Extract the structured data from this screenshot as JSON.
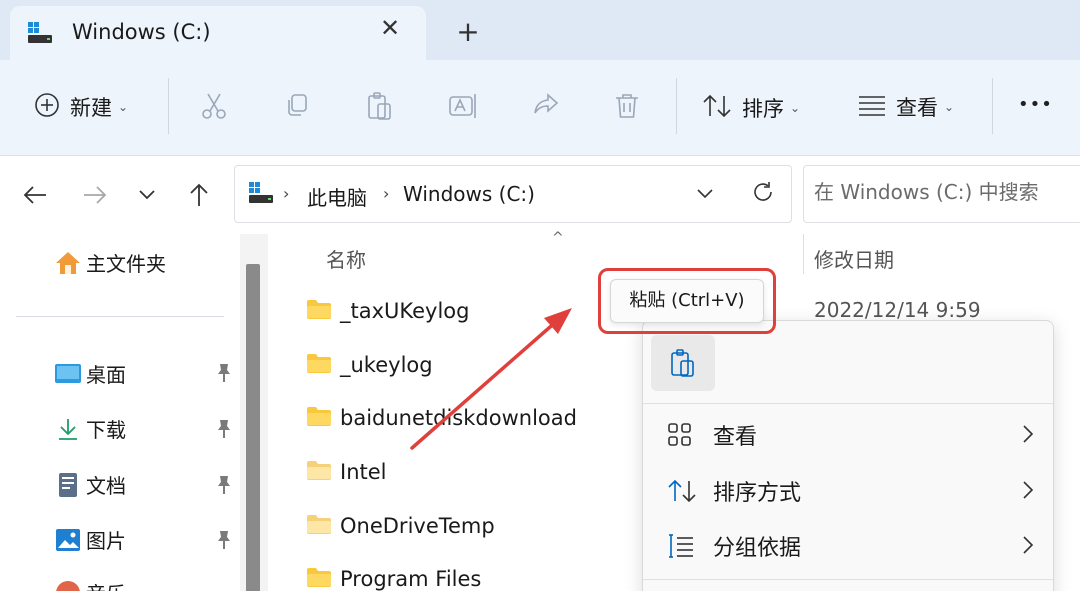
{
  "window": {
    "tab_title": "Windows (C:)",
    "close_symbol": "✕",
    "new_tab_symbol": "+"
  },
  "toolbar": {
    "new_label": "新建",
    "sort_label": "排序",
    "view_label": "查看",
    "more_symbol": "•••",
    "chevron": "⌄"
  },
  "address": {
    "crumbs": [
      "此电脑",
      "Windows (C:)"
    ],
    "separator": "›"
  },
  "search": {
    "placeholder": "在 Windows (C:) 中搜索"
  },
  "nav_pane": {
    "home": "主文件夹",
    "items": [
      "桌面",
      "下载",
      "文档",
      "图片",
      "音乐"
    ]
  },
  "file_list": {
    "columns": {
      "name": "名称",
      "date": "修改日期"
    },
    "sort_caret": "^",
    "files": [
      "_taxUKeylog",
      "_ukeylog",
      "baidunetdiskdownload",
      "Intel",
      "OneDriveTemp",
      "Program Files"
    ],
    "first_date": "2022/12/14 9:59"
  },
  "tooltip": {
    "text": "粘贴 (Ctrl+V)"
  },
  "context_menu": {
    "items": [
      "查看",
      "排序方式",
      "分组依据"
    ]
  },
  "colors": {
    "accent": "#0067c0",
    "highlight_red": "#e0403c",
    "folder": "#f8c93e"
  }
}
